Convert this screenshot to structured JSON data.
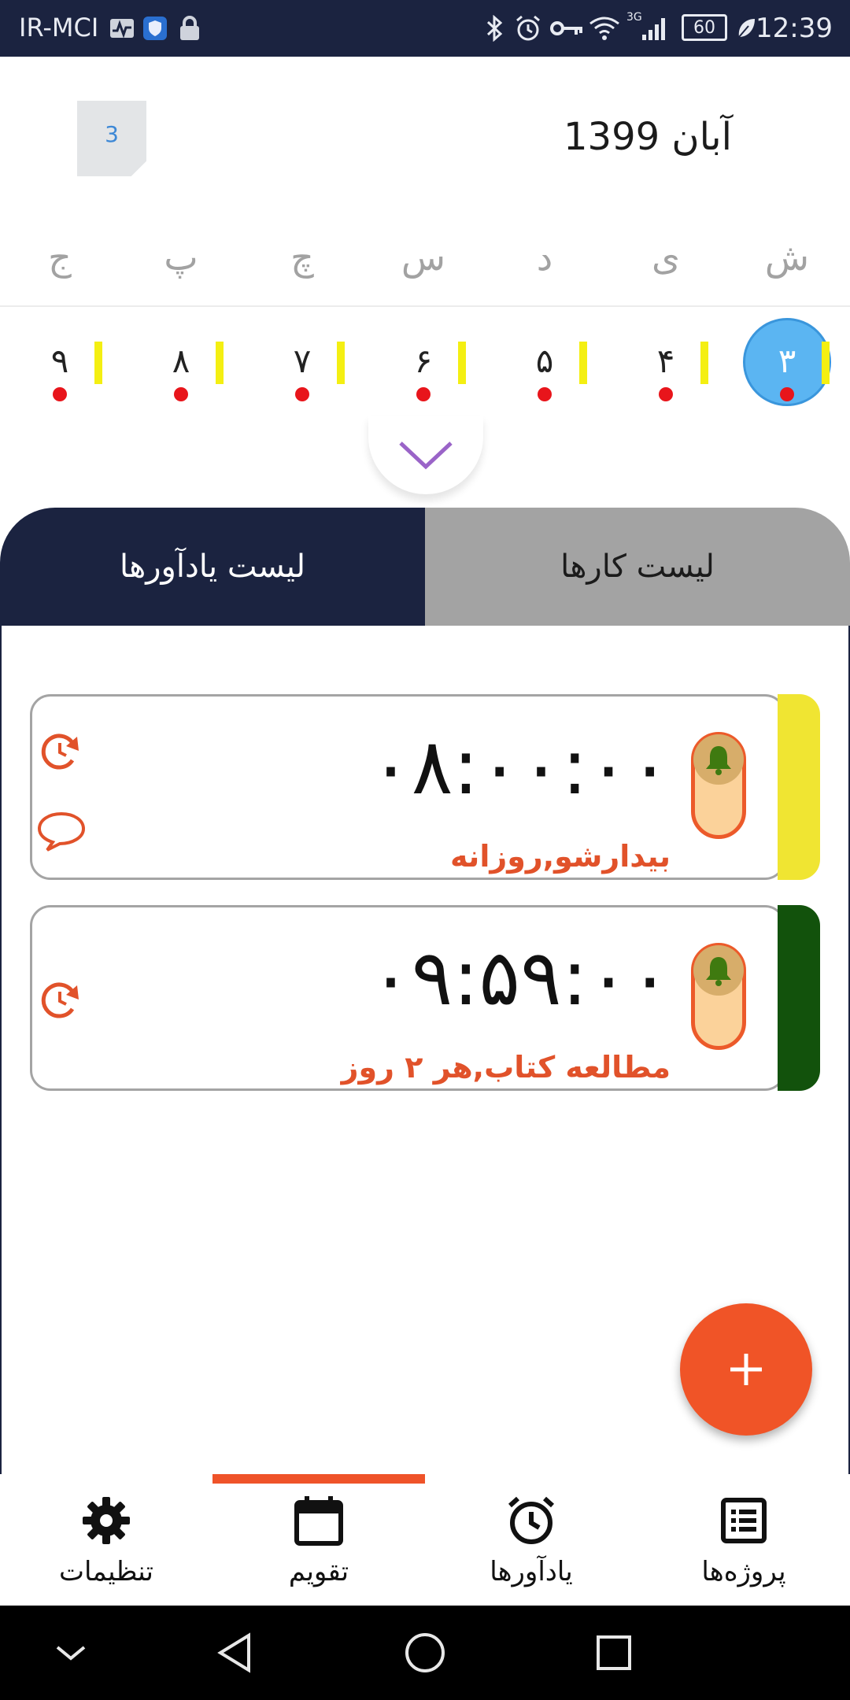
{
  "status_bar": {
    "carrier": "IR-MCI",
    "network_type": "3G",
    "battery": "60",
    "time": "12:39",
    "icons": [
      "activity-icon",
      "shield-icon",
      "lock-icon",
      "bluetooth-icon",
      "alarm-icon",
      "key-icon",
      "wifi-icon",
      "signal-icon",
      "battery-icon",
      "leaf-icon"
    ]
  },
  "calendar": {
    "month_title": "آبان 1399",
    "today_chip": "3",
    "weekdays": [
      "ش",
      "ی",
      "د",
      "س",
      "چ",
      "پ",
      "ج"
    ],
    "days": [
      "۳",
      "۴",
      "۵",
      "۶",
      "۷",
      "۸",
      "۹"
    ],
    "selected_day": "۳",
    "colors": {
      "selected": "#5bb5f2",
      "marker": "#f4ef12",
      "event_dot": "#e8151b"
    }
  },
  "tabs": {
    "reminders": "لیست یادآورها",
    "tasks": "لیست کارها",
    "active": "reminders"
  },
  "reminders": [
    {
      "time": "۰۸:۰۰:۰۰",
      "title": "بیدارشو,روزانه",
      "stripe_color": "#f0e532",
      "icons": [
        "repeat-icon",
        "comment-icon"
      ]
    },
    {
      "time": "۰۹:۵۹:۰۰",
      "title": "مطالعه کتاب,هر ۲ روز",
      "stripe_color": "#12520c",
      "icons": [
        "repeat-icon"
      ]
    }
  ],
  "fab": {
    "icon": "plus-icon",
    "color": "#f05427"
  },
  "bottom_nav": {
    "items": [
      {
        "label": "تنظیمات",
        "icon": "gear-icon"
      },
      {
        "label": "تقویم",
        "icon": "calendar-icon"
      },
      {
        "label": "یادآورها",
        "icon": "alarm-clock-icon"
      },
      {
        "label": "پروژه‌ها",
        "icon": "list-icon"
      }
    ],
    "active": "تقویم",
    "accent": "#ef5329"
  }
}
